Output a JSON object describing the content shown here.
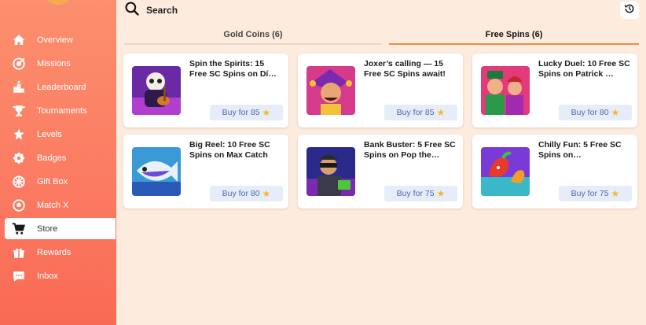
{
  "sidebar": {
    "items": [
      {
        "label": "Overview",
        "icon": "home-icon"
      },
      {
        "label": "Missions",
        "icon": "target-icon"
      },
      {
        "label": "Leaderboard",
        "icon": "podium-icon"
      },
      {
        "label": "Tournaments",
        "icon": "trophy-icon"
      },
      {
        "label": "Levels",
        "icon": "star-burst-icon"
      },
      {
        "label": "Badges",
        "icon": "badge-icon"
      },
      {
        "label": "Gift Box",
        "icon": "wheel-icon"
      },
      {
        "label": "Match X",
        "icon": "ball-icon"
      },
      {
        "label": "Store",
        "icon": "cart-icon",
        "active": true
      },
      {
        "label": "Rewards",
        "icon": "gift-icon"
      },
      {
        "label": "Inbox",
        "icon": "chat-icon"
      }
    ]
  },
  "search": {
    "label": "Search",
    "icon": "search-icon"
  },
  "history_icon": "history-icon",
  "tabs": [
    {
      "label": "Gold Coins (6)",
      "active": false
    },
    {
      "label": "Free Spins (6)",
      "active": true
    }
  ],
  "cards": [
    {
      "title": "Spin the Spirits: 15 Free SC Spins on Dí…",
      "button": "Buy for 85",
      "image": "skeleton-guitarist-art"
    },
    {
      "title": "Joxer’s calling — 15 Free SC Spins await!",
      "button": "Buy for 85",
      "image": "jester-art"
    },
    {
      "title": "Lucky Duel: 10 Free SC Spins on Patrick …",
      "button": "Buy for 80",
      "image": "leprechaun-duo-art"
    },
    {
      "title": "Big Reel: 10 Free SC Spins on Max Catch",
      "button": "Buy for 80",
      "image": "fish-art"
    },
    {
      "title": "Bank Buster: 5 Free SC Spins on Pop the…",
      "button": "Buy for 75",
      "image": "robber-art"
    },
    {
      "title": "Chilly Fun: 5 Free SC Spins on…",
      "button": "Buy for 75",
      "image": "chili-art"
    }
  ],
  "colors": {
    "sidebar": "#fb7a61",
    "accent": "#f08a44",
    "button_bg": "#e6edf8",
    "button_text": "#4a68b6",
    "page_bg": "#fdecdd"
  }
}
